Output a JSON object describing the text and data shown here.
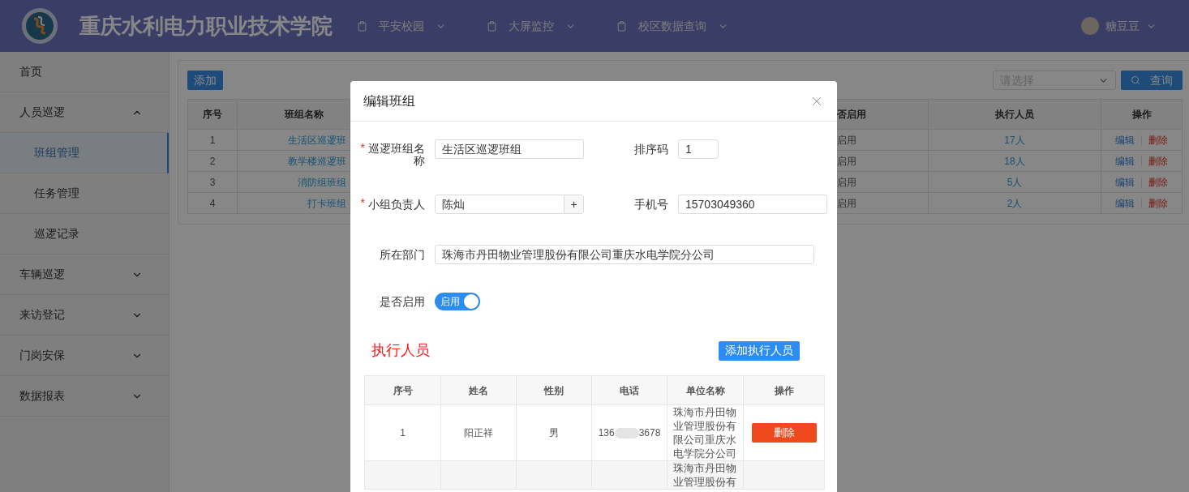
{
  "header": {
    "title": "重庆水利电力职业技术学院",
    "nav": [
      {
        "label": "平安校园"
      },
      {
        "label": "大屏监控"
      },
      {
        "label": "校区数据查询"
      }
    ],
    "user": {
      "name": "糖豆豆"
    }
  },
  "sidebar": {
    "items": [
      {
        "label": "首页",
        "selected": false
      },
      {
        "label": "人员巡逻",
        "selected": false,
        "expanded": true,
        "children": [
          {
            "label": "班组管理",
            "selected": true
          },
          {
            "label": "任务管理",
            "selected": false
          },
          {
            "label": "巡逻记录",
            "selected": false
          }
        ]
      },
      {
        "label": "车辆巡逻",
        "selected": false,
        "expanded": false
      },
      {
        "label": "来访登记",
        "selected": false,
        "expanded": false
      },
      {
        "label": "门岗安保",
        "selected": false,
        "expanded": false
      },
      {
        "label": "数据报表",
        "selected": false,
        "expanded": false
      }
    ]
  },
  "toolbar": {
    "add_button": "添加",
    "select": {
      "placeholder": "请选择"
    },
    "query_button": "查询"
  },
  "table": {
    "columns": [
      "序号",
      "班组名称",
      "否启用",
      "执行人员",
      "操作"
    ],
    "rows": [
      {
        "cells": [
          "1",
          "生活区巡逻班",
          "启用",
          "17人"
        ],
        "actions": [
          "编辑",
          "删除"
        ]
      },
      {
        "cells": [
          "2",
          "教学楼巡逻班",
          "启用",
          "18人"
        ],
        "actions": [
          "编辑",
          "删除"
        ]
      },
      {
        "cells": [
          "3",
          "消防组班组",
          "启用",
          "5人"
        ],
        "actions": [
          "编辑",
          "删除"
        ]
      },
      {
        "cells": [
          "4",
          "打卡班组",
          "启用",
          "2人"
        ],
        "actions": [
          "编辑",
          "删除"
        ]
      }
    ]
  },
  "dialog": {
    "title": "编辑班组",
    "required_mark": "*",
    "form_rows": [
      [
        {
          "label": "巡逻班组名称",
          "required": true,
          "value": "生活区巡逻班组"
        },
        {
          "label": "排序码",
          "required": false,
          "value": "1"
        }
      ],
      [
        {
          "label": "小组负责人",
          "required": true,
          "value": "陈灿",
          "addon": "+"
        },
        {
          "label": "手机号",
          "required": false,
          "value": "15703049360"
        }
      ],
      [
        {
          "label": "所在部门",
          "required": false,
          "value": "珠海市丹田物业管理股份有限公司重庆水电学院分公司"
        }
      ]
    ],
    "switch": {
      "label": "是否启用",
      "on": true,
      "text": "启用"
    },
    "section_title": "执行人员",
    "add_button": "添加执行人员",
    "table": {
      "columns": [
        "序号",
        "姓名",
        "性别",
        "电话",
        "单位名称",
        "操作"
      ],
      "rows": [
        {
          "seq": "1",
          "name": "阳正祥",
          "gender": "男",
          "phone_parts": [
            "136",
            "3678"
          ],
          "unit": "珠海市丹田物业管理股份有限公司重庆水电学院分公司",
          "action": "删除"
        },
        {
          "unit": "珠海市丹田物业管理股份有"
        }
      ]
    }
  }
}
